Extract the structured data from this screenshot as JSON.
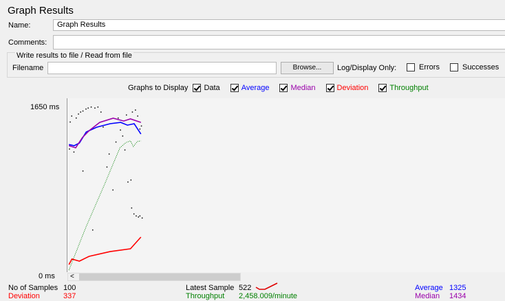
{
  "title": "Graph Results",
  "name": {
    "label": "Name:",
    "value": "Graph Results"
  },
  "comments": {
    "label": "Comments:",
    "value": ""
  },
  "file_group": {
    "title": "Write results to file / Read from file",
    "filename_label": "Filename",
    "filename_value": "",
    "browse_label": "Browse...",
    "log_display_label": "Log/Display Only:",
    "errors": {
      "label": "Errors",
      "checked": false
    },
    "successes": {
      "label": "Successes",
      "checked": false
    }
  },
  "graphs_to_display": {
    "label": "Graphs to Display",
    "options": [
      {
        "label": "Data",
        "checked": true,
        "color": "#000000"
      },
      {
        "label": "Average",
        "checked": true,
        "color": "#0000ff"
      },
      {
        "label": "Median",
        "checked": true,
        "color": "#9900aa"
      },
      {
        "label": "Deviation",
        "checked": true,
        "color": "#ff0000"
      },
      {
        "label": "Throughput",
        "checked": true,
        "color": "#008000"
      }
    ]
  },
  "stats": {
    "samples_label": "No of Samples",
    "samples_value": "100",
    "deviation_label": "Deviation",
    "deviation_value": "337",
    "latest_label": "Latest Sample",
    "latest_value": "522",
    "throughput_label": "Throughput",
    "throughput_value": "2,458.009/minute",
    "average_label": "Average",
    "average_value": "1325",
    "median_label": "Median",
    "median_value": "1434"
  },
  "chart_data": {
    "type": "line",
    "ylim": [
      0,
      1650
    ],
    "xlim": [
      0,
      100
    ],
    "yticks": [
      "1650 ms",
      "0 ms"
    ],
    "series": [
      {
        "key": "average",
        "color": "#0000ff",
        "points": [
          [
            2,
            1270
          ],
          [
            9,
            1258
          ],
          [
            16,
            1285
          ],
          [
            25,
            1395
          ],
          [
            39,
            1443
          ],
          [
            57,
            1478
          ],
          [
            71,
            1491
          ],
          [
            80,
            1464
          ],
          [
            89,
            1478
          ],
          [
            98,
            1375
          ]
        ]
      },
      {
        "key": "median",
        "color": "#9900aa",
        "points": [
          [
            2,
            1258
          ],
          [
            11,
            1237
          ],
          [
            20,
            1340
          ],
          [
            29,
            1409
          ],
          [
            43,
            1491
          ],
          [
            61,
            1533
          ],
          [
            75,
            1505
          ],
          [
            84,
            1526
          ],
          [
            98,
            1491
          ]
        ]
      },
      {
        "key": "throughput",
        "color": "#008000",
        "points": [
          [
            2,
            14
          ],
          [
            25,
            450
          ],
          [
            50,
            880
          ],
          [
            70,
            1237
          ],
          [
            78,
            1290
          ],
          [
            84,
            1306
          ],
          [
            88,
            1250
          ],
          [
            93,
            1300
          ],
          [
            98,
            1306
          ]
        ]
      },
      {
        "key": "deviation",
        "color": "#ff0000",
        "points": [
          [
            2,
            69
          ],
          [
            6,
            124
          ],
          [
            16,
            103
          ],
          [
            29,
            151
          ],
          [
            57,
            199
          ],
          [
            84,
            227
          ],
          [
            98,
            344
          ]
        ]
      }
    ],
    "data_points": [
      [
        2,
        1230
      ],
      [
        3,
        1500
      ],
      [
        5,
        1560
      ],
      [
        8,
        1200
      ],
      [
        11,
        1540
      ],
      [
        14,
        1580
      ],
      [
        17,
        1600
      ],
      [
        20,
        1610
      ],
      [
        24,
        1630
      ],
      [
        27,
        1640
      ],
      [
        31,
        1650
      ],
      [
        36,
        1640
      ],
      [
        40,
        1650
      ],
      [
        44,
        1600
      ],
      [
        47,
        1450
      ],
      [
        52,
        1050
      ],
      [
        55,
        1180
      ],
      [
        60,
        820
      ],
      [
        64,
        1300
      ],
      [
        70,
        1420
      ],
      [
        73,
        1360
      ],
      [
        76,
        1220
      ],
      [
        80,
        900
      ],
      [
        84,
        920
      ],
      [
        86,
        1600
      ],
      [
        90,
        1620
      ],
      [
        93,
        1560
      ],
      [
        96,
        1430
      ],
      [
        98,
        1460
      ],
      [
        85,
        640
      ],
      [
        88,
        580
      ],
      [
        91,
        560
      ],
      [
        94,
        550
      ],
      [
        96,
        560
      ],
      [
        99,
        540
      ],
      [
        33,
        420
      ],
      [
        20,
        1010
      ],
      [
        67,
        1540
      ],
      [
        78,
        1570
      ]
    ]
  }
}
